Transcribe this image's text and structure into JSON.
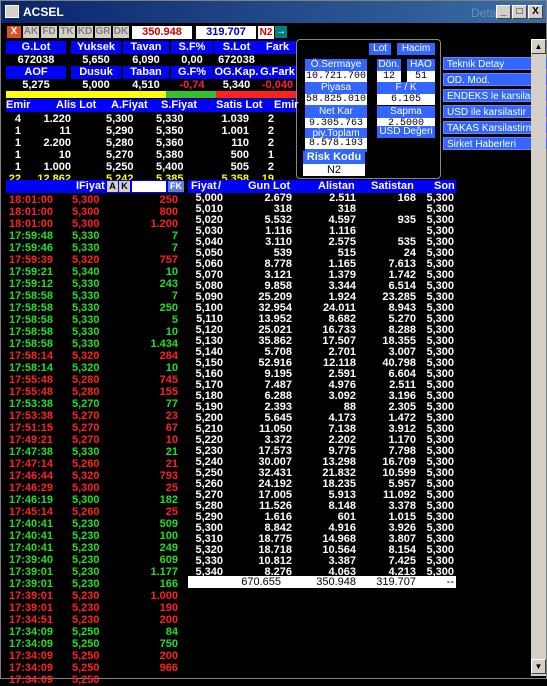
{
  "window": {
    "title": "ACSEL",
    "detail_label": "Detay",
    "btn_min": "_",
    "btn_max": "□",
    "btn_close": "X"
  },
  "toolbar": {
    "close_btn": "X",
    "tabs": [
      "AK",
      "FD",
      "TK",
      "KD",
      "GR",
      "DK"
    ],
    "price": "350.948",
    "value": "319.707",
    "n2": "N2",
    "arrow": "→"
  },
  "summary": {
    "row1_headers": [
      "G.Lot",
      "Yuksek",
      "Tavan",
      "S.F%",
      "S.Lot",
      "Fark"
    ],
    "row1_values": [
      "672038",
      "5,650",
      "6,090",
      "0,00",
      "672038",
      ""
    ],
    "row2_headers": [
      "AOF",
      "Dusuk",
      "Taban",
      "G.F%",
      "OG.Kap.",
      "G.Fark"
    ],
    "row2_values": [
      "5,275",
      "5,000",
      "4,510",
      "-0,74",
      "5,340",
      "-0,040"
    ]
  },
  "panel": {
    "lot_btn": "Lot",
    "hacim_btn": "Hacim",
    "osermaye_label": "Ö.Sermaye",
    "osermaye_value": "10.721.700",
    "don_label": "Dön.",
    "don_value": "12",
    "hao_label": "HAO",
    "hao_value": "51",
    "piyasa_label": "Piyasa Değeri",
    "piyasa_value": "58.825.010",
    "fk_label": "F / K",
    "fk_value": "6.105",
    "netkar_label": "Net Kar",
    "netkar_value": "9.305.763",
    "sapma_label": "Sapma",
    "sapma_value": "2.5000",
    "piytop_label": "piy.Toplam Lot",
    "piytop_value": "8.578.193",
    "usd_label": "USD Değeri",
    "risk_label": "Risk Kodu",
    "risk_value": "N2"
  },
  "right_menu": [
    "Teknik Detay",
    "OD. Mod.",
    "ENDEKS le karsilast",
    "USD ile karsilastir",
    "TAKAS Karsilastirm",
    "Sirket Haberleri"
  ],
  "depth": {
    "headers": [
      "Emir",
      "Alis Lot",
      "A.Fiyat",
      "S.Fiyat",
      "Satis Lot",
      "Emir"
    ],
    "rows": [
      [
        "4",
        "1.220",
        "5,300",
        "5,330",
        "1.039",
        "2"
      ],
      [
        "1",
        "11",
        "5,290",
        "5,350",
        "1.001",
        "2"
      ],
      [
        "1",
        "2.200",
        "5,280",
        "5,360",
        "110",
        "2"
      ],
      [
        "1",
        "10",
        "5,270",
        "5,380",
        "500",
        "1"
      ],
      [
        "1",
        "1.000",
        "5,250",
        "5,400",
        "505",
        "2"
      ],
      [
        "22",
        "12.862",
        "5,242",
        "5,385",
        "5.358",
        "19"
      ]
    ]
  },
  "trades": {
    "header_label": "IFiyat",
    "a_btn": "A",
    "k_btn": "K",
    "fk_btn": "FK",
    "rows": [
      [
        "18:01:00",
        "5,300",
        "250",
        "r"
      ],
      [
        "18:01:00",
        "5,300",
        "800",
        "r"
      ],
      [
        "18:01:00",
        "5,300",
        "1.200",
        "r"
      ],
      [
        "17:59:48",
        "5,330",
        "7",
        "g"
      ],
      [
        "17:59:46",
        "5,330",
        "7",
        "g"
      ],
      [
        "17:59:39",
        "5,320",
        "757",
        "r"
      ],
      [
        "17:59:21",
        "5,340",
        "10",
        "g"
      ],
      [
        "17:59:12",
        "5,330",
        "243",
        "g"
      ],
      [
        "17:58:58",
        "5,330",
        "7",
        "g"
      ],
      [
        "17:58:58",
        "5,330",
        "250",
        "g"
      ],
      [
        "17:58:58",
        "5,330",
        "5",
        "g"
      ],
      [
        "17:58:58",
        "5,330",
        "10",
        "g"
      ],
      [
        "17:58:58",
        "5,330",
        "1.434",
        "g"
      ],
      [
        "17:58:14",
        "5,320",
        "284",
        "r"
      ],
      [
        "17:58:14",
        "5,320",
        "10",
        "g"
      ],
      [
        "17:55:48",
        "5,280",
        "745",
        "r"
      ],
      [
        "17:55:48",
        "5,280",
        "155",
        "r"
      ],
      [
        "17:53:38",
        "5,270",
        "77",
        "g"
      ],
      [
        "17:53:38",
        "5,270",
        "23",
        "r"
      ],
      [
        "17:51:15",
        "5,270",
        "67",
        "r"
      ],
      [
        "17:49:21",
        "5,270",
        "10",
        "r"
      ],
      [
        "17:47:38",
        "5,330",
        "21",
        "g"
      ],
      [
        "17:47:14",
        "5,260",
        "21",
        "r"
      ],
      [
        "17:46:44",
        "5,320",
        "793",
        "r"
      ],
      [
        "17:46:29",
        "5,300",
        "25",
        "r"
      ],
      [
        "17:46:19",
        "5,300",
        "182",
        "g"
      ],
      [
        "17:45:14",
        "5,260",
        "25",
        "r"
      ],
      [
        "17:40:41",
        "5,230",
        "509",
        "g"
      ],
      [
        "17:40:41",
        "5,230",
        "100",
        "g"
      ],
      [
        "17:40:41",
        "5,230",
        "249",
        "g"
      ],
      [
        "17:39:40",
        "5,230",
        "609",
        "g"
      ],
      [
        "17:39:01",
        "5,230",
        "1.177",
        "g"
      ],
      [
        "17:39:01",
        "5,230",
        "166",
        "g"
      ],
      [
        "17:39:01",
        "5,230",
        "1.000",
        "r"
      ],
      [
        "17:39:01",
        "5,230",
        "190",
        "r"
      ],
      [
        "17:34:51",
        "5,230",
        "200",
        "r"
      ],
      [
        "17:34:09",
        "5,250",
        "84",
        "g"
      ],
      [
        "17:34:09",
        "5,250",
        "750",
        "g"
      ],
      [
        "17:34:09",
        "5,250",
        "200",
        "r"
      ],
      [
        "17:34:09",
        "5,250",
        "966",
        "r"
      ],
      [
        "17:34:09",
        "5,250",
        "",
        "r"
      ]
    ]
  },
  "dist": {
    "headers": [
      "Fiyat",
      "Gun Lot",
      "Alistan",
      "Satistan",
      "Son"
    ],
    "rows": [
      [
        "5,000",
        "2.679",
        "2.511",
        "168",
        "5,300"
      ],
      [
        "5,010",
        "318",
        "318",
        "",
        "5,300"
      ],
      [
        "5,020",
        "5.532",
        "4.597",
        "935",
        "5,300"
      ],
      [
        "5,030",
        "1.116",
        "1.116",
        "",
        "5,300"
      ],
      [
        "5,040",
        "3.110",
        "2.575",
        "535",
        "5,300"
      ],
      [
        "5,050",
        "539",
        "515",
        "24",
        "5,300"
      ],
      [
        "5,060",
        "8.778",
        "1.165",
        "7.613",
        "5,300"
      ],
      [
        "5,070",
        "3.121",
        "1.379",
        "1.742",
        "5,300"
      ],
      [
        "5,080",
        "9.858",
        "3.344",
        "6.514",
        "5,300"
      ],
      [
        "5,090",
        "25.209",
        "1.924",
        "23.285",
        "5,300"
      ],
      [
        "5,100",
        "32.954",
        "24.011",
        "8.943",
        "5,300"
      ],
      [
        "5,110",
        "13.952",
        "8.682",
        "5.270",
        "5,300"
      ],
      [
        "5,120",
        "25.021",
        "16.733",
        "8.288",
        "5,300"
      ],
      [
        "5,130",
        "35.862",
        "17.507",
        "18.355",
        "5,300"
      ],
      [
        "5,140",
        "5.708",
        "2.701",
        "3.007",
        "5,300"
      ],
      [
        "5,150",
        "52.916",
        "12.118",
        "40.798",
        "5,300"
      ],
      [
        "5,160",
        "9.195",
        "2.591",
        "6.604",
        "5,300"
      ],
      [
        "5,170",
        "7.487",
        "4.976",
        "2.511",
        "5,300"
      ],
      [
        "5,180",
        "6.288",
        "3.092",
        "3.196",
        "5,300"
      ],
      [
        "5,190",
        "2.393",
        "88",
        "2.305",
        "5,300"
      ],
      [
        "5,200",
        "5.645",
        "4.173",
        "1.472",
        "5,300"
      ],
      [
        "5,210",
        "11.050",
        "7.138",
        "3.912",
        "5,300"
      ],
      [
        "5,220",
        "3.372",
        "2.202",
        "1.170",
        "5,300"
      ],
      [
        "5,230",
        "17.573",
        "9.775",
        "7.798",
        "5,300"
      ],
      [
        "5,240",
        "30.007",
        "13.298",
        "16.709",
        "5,300"
      ],
      [
        "5,250",
        "32.431",
        "21.832",
        "10.599",
        "5,300"
      ],
      [
        "5,260",
        "24.192",
        "18.235",
        "5.957",
        "5,300"
      ],
      [
        "5,270",
        "17.005",
        "5.913",
        "11.092",
        "5,300"
      ],
      [
        "5,280",
        "11.526",
        "8.148",
        "3.378",
        "5,300"
      ],
      [
        "5,290",
        "1.616",
        "601",
        "1.015",
        "5,300"
      ],
      [
        "5,300",
        "8.842",
        "4.916",
        "3.926",
        "5,300"
      ],
      [
        "5,310",
        "18.775",
        "14.968",
        "3.807",
        "5,300"
      ],
      [
        "5,320",
        "18.718",
        "10.564",
        "8.154",
        "5,300"
      ],
      [
        "5,330",
        "10.812",
        "3.387",
        "7.425",
        "5,300"
      ],
      [
        "5,340",
        "8.276",
        "4.063",
        "4.213",
        "5,300"
      ]
    ],
    "totals": [
      "670.655",
      "350.948",
      "319.707",
      "--"
    ]
  },
  "colors": {
    "red": "#ff2020",
    "green": "#20e020",
    "blue": "#0000ff",
    "yellow": "#ffff00"
  }
}
